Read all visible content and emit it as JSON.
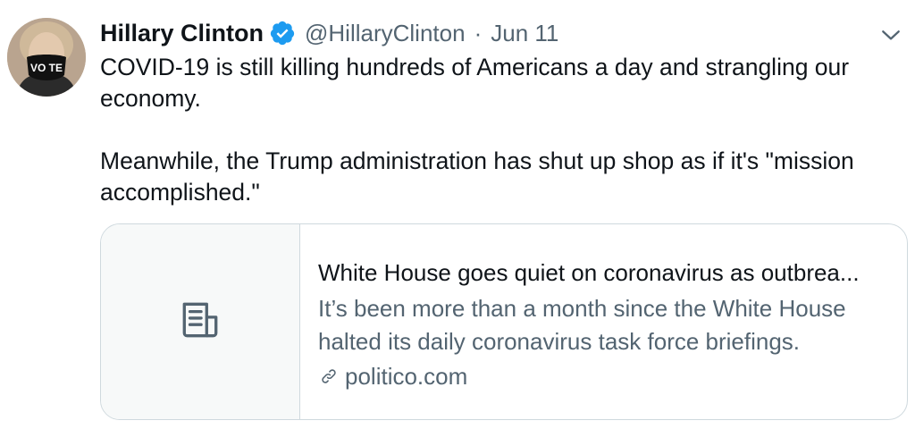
{
  "author": {
    "display_name": "Hillary Clinton",
    "handle": "@HillaryClinton",
    "separator": "·",
    "date": "Jun 11",
    "avatar_mask_text": "VO TE"
  },
  "tweet": {
    "paragraphs": [
      "COVID-19 is still killing hundreds of Americans a day and strangling our economy.",
      "Meanwhile, the Trump administration has shut up shop as if it's \"mission accomplished.\""
    ]
  },
  "link_card": {
    "title": "White House goes quiet on coronavirus as outbrea...",
    "description": "It’s been more than a month since the White House halted its daily coronavirus task force briefings.",
    "domain": "politico.com",
    "media_icon": "article-icon"
  },
  "colors": {
    "text_primary": "#0f1419",
    "text_secondary": "#536471",
    "verified_blue": "#1d9bf0",
    "card_border": "#cfd9de",
    "card_media_bg": "#f7f9f9"
  }
}
